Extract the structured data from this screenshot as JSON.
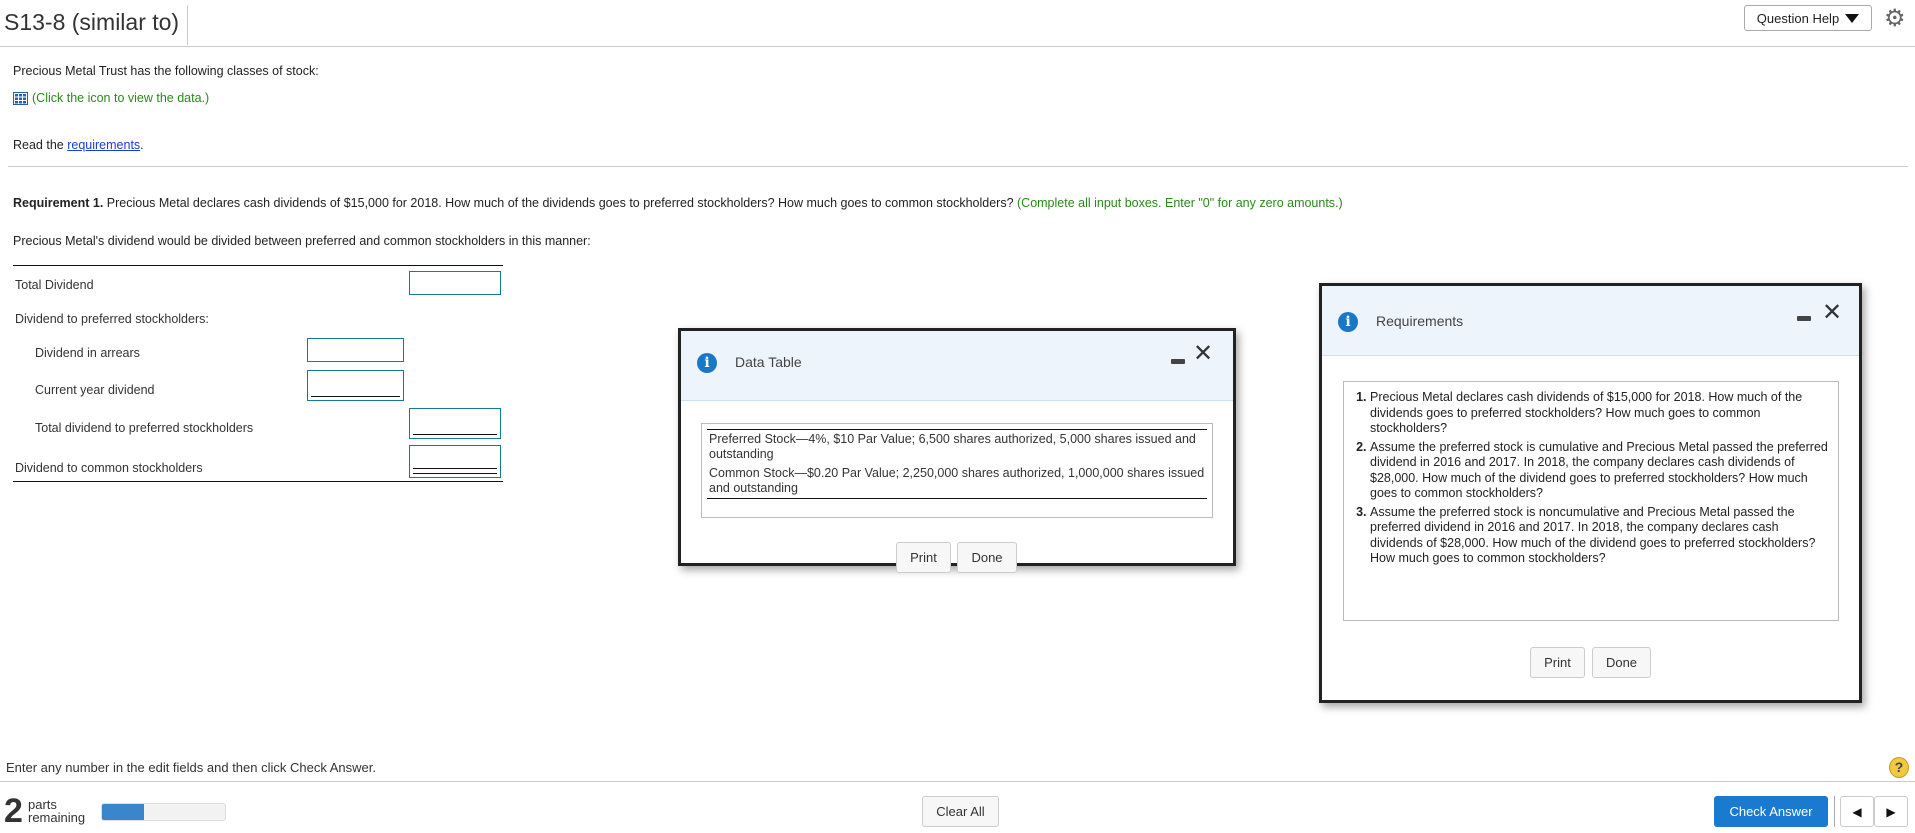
{
  "header": {
    "title": "S13-8 (similar to)",
    "question_help": "Question Help",
    "gear_icon": "gear-icon"
  },
  "question": {
    "intro": "Precious Metal Trust has the following classes of stock:",
    "data_link": "(Click the icon to view the data.)",
    "read_prefix": "Read the ",
    "read_link": "requirements",
    "read_suffix": ".",
    "req_label": "Requirement 1.",
    "req_text": " Precious Metal declares cash dividends of $15,000 for 2018. How much of the dividends goes to preferred stockholders? How much goes to common stockholders? ",
    "req_hint": "(Complete all input boxes. Enter \"0\" for any zero amounts.)",
    "table_intro": "Precious Metal's dividend would be divided between preferred and common stockholders in this manner:",
    "rows": [
      {
        "label": "Total Dividend",
        "value": ""
      },
      {
        "label": "Dividend to preferred stockholders:"
      },
      {
        "label": "Dividend in arrears",
        "value": ""
      },
      {
        "label": "Current year dividend",
        "value": ""
      },
      {
        "label": "Total dividend to preferred stockholders",
        "value": ""
      },
      {
        "label": "Dividend to common stockholders",
        "value": ""
      }
    ]
  },
  "data_dialog": {
    "title": "Data Table",
    "rows": [
      "Preferred Stock—4%, $10 Par Value; 6,500 shares authorized, 5,000 shares issued and outstanding",
      "Common Stock—$0.20 Par Value; 2,250,000 shares authorized, 1,000,000 shares issued and outstanding"
    ],
    "print": "Print",
    "done": "Done"
  },
  "req_dialog": {
    "title": "Requirements",
    "items": [
      "Precious Metal declares cash dividends of $15,000 for 2018. How much of the dividends goes to preferred stockholders? How much goes to common stockholders?",
      "Assume the preferred stock is cumulative and Precious Metal passed the preferred dividend in 2016 and 2017. In 2018, the company declares cash dividends of $28,000. How much of the dividend goes to preferred stockholders? How much goes to common stockholders?",
      "Assume the preferred stock is noncumulative and Precious Metal passed the preferred dividend in 2016 and 2017. In 2018, the company declares cash dividends of $28,000. How much of the dividend goes to preferred stockholders? How much goes to common stockholders?"
    ],
    "print": "Print",
    "done": "Done"
  },
  "footer": {
    "instruction": "Enter any number in the edit fields and then click Check Answer.",
    "parts_count": "2",
    "parts_label1": "parts",
    "parts_label2": "remaining",
    "progress_percent": 34,
    "clear_all": "Clear All",
    "check_answer": "Check Answer",
    "accent": "#1a7ad0"
  }
}
